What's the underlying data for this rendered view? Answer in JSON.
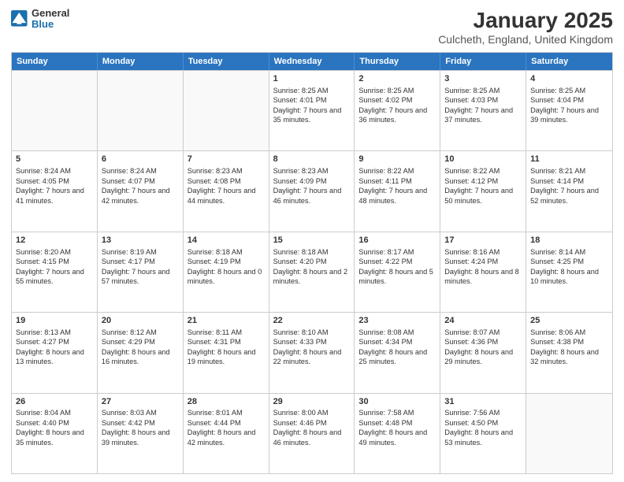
{
  "logo": {
    "general": "General",
    "blue": "Blue"
  },
  "title": "January 2025",
  "subtitle": "Culcheth, England, United Kingdom",
  "days": [
    "Sunday",
    "Monday",
    "Tuesday",
    "Wednesday",
    "Thursday",
    "Friday",
    "Saturday"
  ],
  "weeks": [
    [
      {
        "day": "",
        "empty": true
      },
      {
        "day": "",
        "empty": true
      },
      {
        "day": "",
        "empty": true
      },
      {
        "day": "1",
        "sunrise": "8:25 AM",
        "sunset": "4:01 PM",
        "daylight": "7 hours and 35 minutes."
      },
      {
        "day": "2",
        "sunrise": "8:25 AM",
        "sunset": "4:02 PM",
        "daylight": "7 hours and 36 minutes."
      },
      {
        "day": "3",
        "sunrise": "8:25 AM",
        "sunset": "4:03 PM",
        "daylight": "7 hours and 37 minutes."
      },
      {
        "day": "4",
        "sunrise": "8:25 AM",
        "sunset": "4:04 PM",
        "daylight": "7 hours and 39 minutes."
      }
    ],
    [
      {
        "day": "5",
        "sunrise": "8:24 AM",
        "sunset": "4:05 PM",
        "daylight": "7 hours and 41 minutes."
      },
      {
        "day": "6",
        "sunrise": "8:24 AM",
        "sunset": "4:07 PM",
        "daylight": "7 hours and 42 minutes."
      },
      {
        "day": "7",
        "sunrise": "8:23 AM",
        "sunset": "4:08 PM",
        "daylight": "7 hours and 44 minutes."
      },
      {
        "day": "8",
        "sunrise": "8:23 AM",
        "sunset": "4:09 PM",
        "daylight": "7 hours and 46 minutes."
      },
      {
        "day": "9",
        "sunrise": "8:22 AM",
        "sunset": "4:11 PM",
        "daylight": "7 hours and 48 minutes."
      },
      {
        "day": "10",
        "sunrise": "8:22 AM",
        "sunset": "4:12 PM",
        "daylight": "7 hours and 50 minutes."
      },
      {
        "day": "11",
        "sunrise": "8:21 AM",
        "sunset": "4:14 PM",
        "daylight": "7 hours and 52 minutes."
      }
    ],
    [
      {
        "day": "12",
        "sunrise": "8:20 AM",
        "sunset": "4:15 PM",
        "daylight": "7 hours and 55 minutes."
      },
      {
        "day": "13",
        "sunrise": "8:19 AM",
        "sunset": "4:17 PM",
        "daylight": "7 hours and 57 minutes."
      },
      {
        "day": "14",
        "sunrise": "8:18 AM",
        "sunset": "4:19 PM",
        "daylight": "8 hours and 0 minutes."
      },
      {
        "day": "15",
        "sunrise": "8:18 AM",
        "sunset": "4:20 PM",
        "daylight": "8 hours and 2 minutes."
      },
      {
        "day": "16",
        "sunrise": "8:17 AM",
        "sunset": "4:22 PM",
        "daylight": "8 hours and 5 minutes."
      },
      {
        "day": "17",
        "sunrise": "8:16 AM",
        "sunset": "4:24 PM",
        "daylight": "8 hours and 8 minutes."
      },
      {
        "day": "18",
        "sunrise": "8:14 AM",
        "sunset": "4:25 PM",
        "daylight": "8 hours and 10 minutes."
      }
    ],
    [
      {
        "day": "19",
        "sunrise": "8:13 AM",
        "sunset": "4:27 PM",
        "daylight": "8 hours and 13 minutes."
      },
      {
        "day": "20",
        "sunrise": "8:12 AM",
        "sunset": "4:29 PM",
        "daylight": "8 hours and 16 minutes."
      },
      {
        "day": "21",
        "sunrise": "8:11 AM",
        "sunset": "4:31 PM",
        "daylight": "8 hours and 19 minutes."
      },
      {
        "day": "22",
        "sunrise": "8:10 AM",
        "sunset": "4:33 PM",
        "daylight": "8 hours and 22 minutes."
      },
      {
        "day": "23",
        "sunrise": "8:08 AM",
        "sunset": "4:34 PM",
        "daylight": "8 hours and 25 minutes."
      },
      {
        "day": "24",
        "sunrise": "8:07 AM",
        "sunset": "4:36 PM",
        "daylight": "8 hours and 29 minutes."
      },
      {
        "day": "25",
        "sunrise": "8:06 AM",
        "sunset": "4:38 PM",
        "daylight": "8 hours and 32 minutes."
      }
    ],
    [
      {
        "day": "26",
        "sunrise": "8:04 AM",
        "sunset": "4:40 PM",
        "daylight": "8 hours and 35 minutes."
      },
      {
        "day": "27",
        "sunrise": "8:03 AM",
        "sunset": "4:42 PM",
        "daylight": "8 hours and 39 minutes."
      },
      {
        "day": "28",
        "sunrise": "8:01 AM",
        "sunset": "4:44 PM",
        "daylight": "8 hours and 42 minutes."
      },
      {
        "day": "29",
        "sunrise": "8:00 AM",
        "sunset": "4:46 PM",
        "daylight": "8 hours and 46 minutes."
      },
      {
        "day": "30",
        "sunrise": "7:58 AM",
        "sunset": "4:48 PM",
        "daylight": "8 hours and 49 minutes."
      },
      {
        "day": "31",
        "sunrise": "7:56 AM",
        "sunset": "4:50 PM",
        "daylight": "8 hours and 53 minutes."
      },
      {
        "day": "",
        "empty": true
      }
    ]
  ]
}
